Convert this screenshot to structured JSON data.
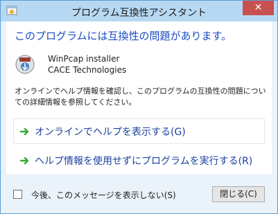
{
  "window": {
    "title": "プログラム互換性アシスタント",
    "close_glyph": "✕"
  },
  "main": {
    "heading": "このプログラムには互換性の問題があります。",
    "program": {
      "name": "WinPcap installer",
      "publisher": "CACE Technologies",
      "icon": "winpcap-installer-icon"
    },
    "description": "オンラインでヘルプ情報を確認し、このプログラムの互換性の問題についての詳細情報を参照してください。",
    "options": [
      {
        "label": "オンラインでヘルプを表示する(G)",
        "icon": "green-arrow-icon"
      },
      {
        "label": "ヘルプ情報を使用せずにプログラムを実行する(R)",
        "icon": "green-arrow-icon"
      }
    ]
  },
  "footer": {
    "checkbox_label": "今後、このメッセージを表示しない(S)",
    "checkbox_checked": false,
    "close_button_label": "閉じる(C)"
  },
  "colors": {
    "titlebar": "#b7d8f2",
    "close_button": "#c75050",
    "heading": "#1a4cc4",
    "option_label": "#1a3f9e",
    "arrow": "#3aa83a"
  }
}
